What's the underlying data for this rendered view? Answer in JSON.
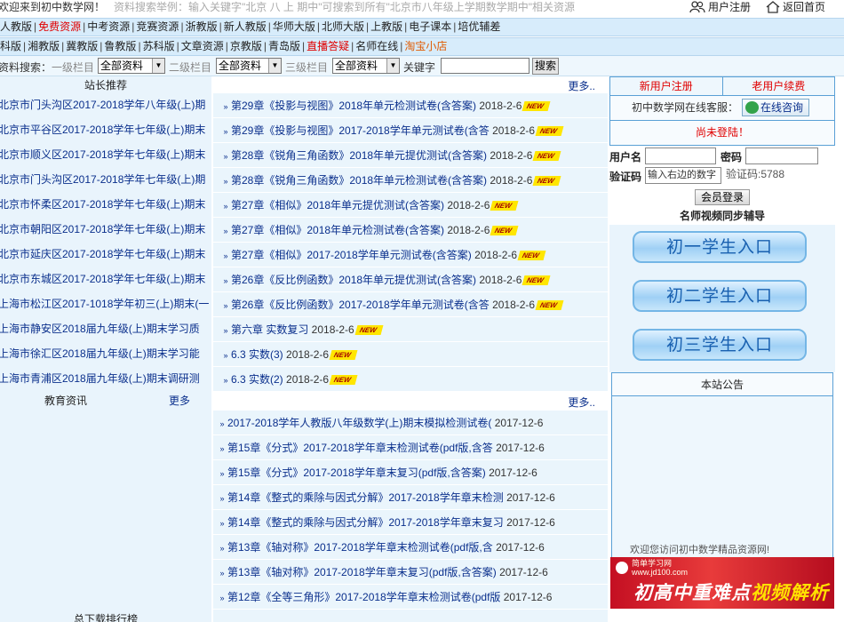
{
  "topbar": {
    "welcome": "欢迎来到初中数学网！",
    "search_example": "资料搜索举例：输入关键字\"北京 八 上 期中\"可搜索到所有\"北京市八年级上学期数学期中\"相关资源",
    "user_register": "用户注册",
    "go_home": "返回首页"
  },
  "nav1": [
    {
      "label": "人教版",
      "style": "normal"
    },
    {
      "label": "免费资源",
      "style": "red"
    },
    {
      "label": "中考资源",
      "style": "normal"
    },
    {
      "label": "竞赛资源",
      "style": "normal"
    },
    {
      "label": "浙教版",
      "style": "normal"
    },
    {
      "label": "新人教版",
      "style": "normal"
    },
    {
      "label": "华师大版",
      "style": "normal"
    },
    {
      "label": "北师大版",
      "style": "normal"
    },
    {
      "label": "上教版",
      "style": "normal"
    },
    {
      "label": "电子课本",
      "style": "normal"
    },
    {
      "label": "培优辅差",
      "style": "normal"
    }
  ],
  "nav2": [
    {
      "label": "科版",
      "style": "normal"
    },
    {
      "label": "湘教版",
      "style": "normal"
    },
    {
      "label": "冀教版",
      "style": "normal"
    },
    {
      "label": "鲁教版",
      "style": "normal"
    },
    {
      "label": "苏科版",
      "style": "normal"
    },
    {
      "label": "文章资源",
      "style": "normal"
    },
    {
      "label": "京教版",
      "style": "normal"
    },
    {
      "label": "青岛版",
      "style": "normal"
    },
    {
      "label": "直播答疑",
      "style": "red"
    },
    {
      "label": "名师在线",
      "style": "normal"
    },
    {
      "label": "淘宝小店",
      "style": "orange"
    }
  ],
  "search": {
    "label": "资料搜索：",
    "level1_label": "一级栏目",
    "level1_value": "全部资料",
    "level2_label": "二级栏目",
    "level2_value": "全部资料",
    "level3_label": "三级栏目",
    "level3_value": "全部资料",
    "keyword_label": "关键字",
    "keyword_value": "",
    "button": "搜索"
  },
  "left": {
    "recommend_title": "站长推荐",
    "recommend_items": [
      "北京市门头沟区2017-2018学年八年级(上)期",
      "北京市平谷区2017-2018学年七年级(上)期末",
      "北京市顺义区2017-2018学年七年级(上)期末",
      "北京市门头沟区2017-2018学年七年级(上)期",
      "北京市怀柔区2017-2018学年七年级(上)期末",
      "北京市朝阳区2017-2018学年七年级(上)期末",
      "北京市延庆区2017-2018学年七年级(上)期末",
      "北京市东城区2017-2018学年七年级(上)期末",
      "上海市松江区2017-1018学年初三(上)期末(一",
      "上海市静安区2018届九年级(上)期末学习质",
      "上海市徐汇区2018届九年级(上)期末学习能",
      "上海市青浦区2018届九年级(上)期末调研测"
    ],
    "edu_title": "教育资讯",
    "edu_more": "更多",
    "rank_title": "总下载排行榜"
  },
  "middle": {
    "more1": "更多..",
    "list1": [
      {
        "title": "第29章《投影与视图》2018年单元检测试卷(含答案)",
        "date": "2018-2-6",
        "new": "NEW"
      },
      {
        "title": "第29章《投影与视图》2017-2018学年单元测试卷(含答",
        "date": "2018-2-6",
        "new": "NEW"
      },
      {
        "title": "第28章《锐角三角函数》2018年单元提优测试(含答案)",
        "date": "2018-2-6",
        "new": "NEW"
      },
      {
        "title": "第28章《锐角三角函数》2018年单元检测试卷(含答案)",
        "date": "2018-2-6",
        "new": "NEW"
      },
      {
        "title": "第27章《相似》2018年单元提优测试(含答案)",
        "date": "2018-2-6",
        "new": "NEW"
      },
      {
        "title": "第27章《相似》2018年单元检测试卷(含答案)",
        "date": "2018-2-6",
        "new": "NEW"
      },
      {
        "title": "第27章《相似》2017-2018学年单元测试卷(含答案)",
        "date": "2018-2-6",
        "new": "NEW"
      },
      {
        "title": "第26章《反比例函数》2018年单元提优测试(含答案)",
        "date": "2018-2-6",
        "new": "NEW"
      },
      {
        "title": "第26章《反比例函数》2017-2018学年单元测试卷(含答",
        "date": "2018-2-6",
        "new": "NEW"
      },
      {
        "title": "第六章 实数复习",
        "date": "2018-2-6",
        "new": "NEW"
      },
      {
        "title": "6.3 实数(3)",
        "date": "2018-2-6",
        "new": "NEW"
      },
      {
        "title": "6.3 实数(2)",
        "date": "2018-2-6",
        "new": "NEW"
      }
    ],
    "more2": "更多..",
    "list2": [
      {
        "title": "2017-2018学年人教版八年级数学(上)期末模拟检测试卷(",
        "date": "2017-12-6"
      },
      {
        "title": "第15章《分式》2017-2018学年章末检测试卷(pdf版,含答",
        "date": "2017-12-6"
      },
      {
        "title": "第15章《分式》2017-2018学年章末复习(pdf版,含答案)",
        "date": "2017-12-6"
      },
      {
        "title": "第14章《整式的乘除与因式分解》2017-2018学年章末检测",
        "date": "2017-12-6"
      },
      {
        "title": "第14章《整式的乘除与因式分解》2017-2018学年章末复习",
        "date": "2017-12-6"
      },
      {
        "title": "第13章《轴对称》2017-2018学年章末检测试卷(pdf版,含",
        "date": "2017-12-6"
      },
      {
        "title": "第13章《轴对称》2017-2018学年章末复习(pdf版,含答案)",
        "date": "2017-12-6"
      },
      {
        "title": "第12章《全等三角形》2017-2018学年章末检测试卷(pdf版",
        "date": "2017-12-6"
      }
    ]
  },
  "right": {
    "new_register": "新用户注册",
    "renew": "老用户续费",
    "service_label": "初中数学网在线客服：",
    "consult": "在线咨询",
    "not_logged": "尚未登陆！",
    "username_label": "用户名",
    "password_label": "密码",
    "vcode_label": "验证码",
    "vcode_placeholder": "输入右边的数字",
    "vcode_hint": "验证码:5788",
    "login_button": "会员登录",
    "video_title": "名师视频同步辅导",
    "entries": [
      "初一学生入口",
      "初二学生入口",
      "初三学生入口"
    ],
    "notice_title": "本站公告",
    "notice_text": "欢迎您访问初中数学精品资源网!",
    "banner_site": "简单学习网",
    "banner_url": "www.jd100.com",
    "banner_text_white": "初高中重难点",
    "banner_text_yellow": "视频解析"
  }
}
